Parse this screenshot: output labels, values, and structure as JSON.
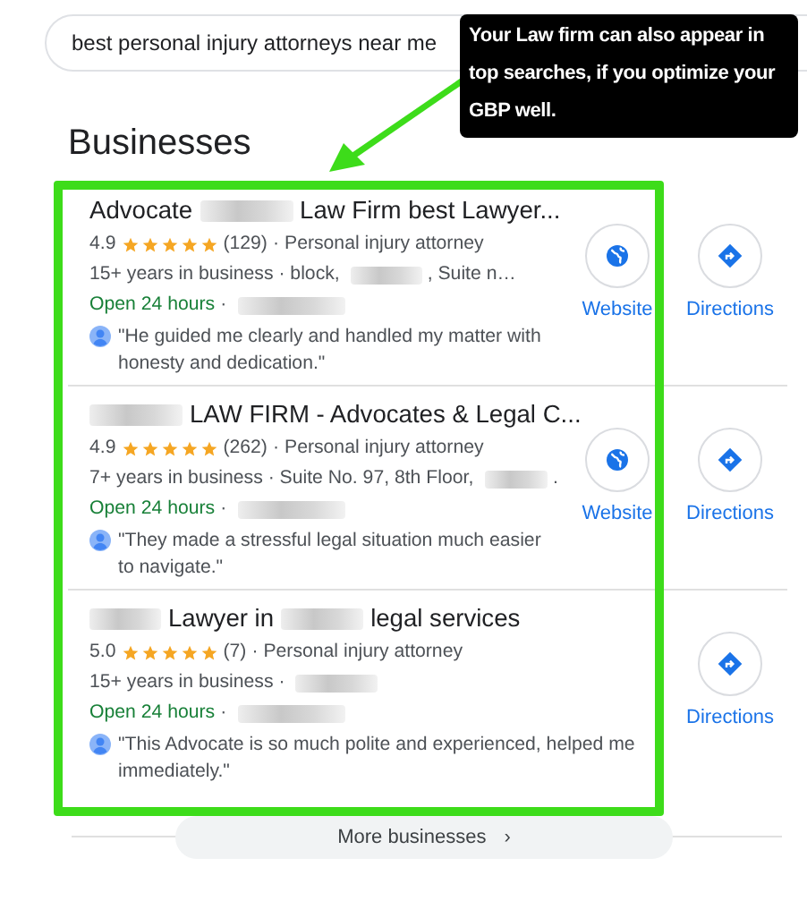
{
  "search": {
    "value": "best personal injury attorneys near me"
  },
  "callout": {
    "text": "Your Law firm can also appear in top searches, if you optimize your GBP well."
  },
  "heading": "Businesses",
  "businesses": [
    {
      "title": [
        {
          "kind": "text",
          "text": "Advocate"
        },
        {
          "kind": "redacted"
        },
        {
          "kind": "text",
          "text": "Law Firm best Lawyer..."
        }
      ],
      "rating": "4.9",
      "stars": 5,
      "reviews": "(129)",
      "separator": "·",
      "category": "Personal injury attorney",
      "details": [
        {
          "kind": "text",
          "text": "15+ years in business · block,"
        },
        {
          "kind": "redacted"
        },
        {
          "kind": "text",
          "text": ", Suite n…"
        }
      ],
      "hours": "Open 24 hours",
      "hours_extra": [
        {
          "kind": "text",
          "text": "·"
        },
        {
          "kind": "redacted"
        }
      ],
      "review": "\"He guided me clearly and handled my matter with honesty and dedication.\"",
      "actions": [
        {
          "kind": "website",
          "label": "Website"
        },
        {
          "kind": "directions",
          "label": "Directions"
        }
      ]
    },
    {
      "title": [
        {
          "kind": "redacted"
        },
        {
          "kind": "text",
          "text": "LAW FIRM - Advocates & Legal C..."
        }
      ],
      "rating": "4.9",
      "stars": 5,
      "reviews": "(262)",
      "separator": "·",
      "category": "Personal injury attorney",
      "details": [
        {
          "kind": "text",
          "text": "7+ years in business · Suite No. 97, 8th Floor,"
        },
        {
          "kind": "redacted"
        },
        {
          "kind": "text",
          "text": "."
        }
      ],
      "hours": "Open 24 hours",
      "hours_extra": [
        {
          "kind": "text",
          "text": "·"
        },
        {
          "kind": "redacted"
        }
      ],
      "review": "\"They made a stressful legal situation much easier to navigate.\"",
      "actions": [
        {
          "kind": "website",
          "label": "Website"
        },
        {
          "kind": "directions",
          "label": "Directions"
        }
      ]
    },
    {
      "title": [
        {
          "kind": "redacted"
        },
        {
          "kind": "text",
          "text": "Lawyer in"
        },
        {
          "kind": "redacted"
        },
        {
          "kind": "text",
          "text": "legal services"
        }
      ],
      "rating": "5.0",
      "stars": 5,
      "reviews": "(7)",
      "separator": "·",
      "category": "Personal injury attorney",
      "details": [
        {
          "kind": "text",
          "text": "15+ years in business ·"
        },
        {
          "kind": "redacted"
        }
      ],
      "hours": "Open 24 hours",
      "hours_extra": [
        {
          "kind": "text",
          "text": "·"
        },
        {
          "kind": "redacted"
        }
      ],
      "review": "\"This Advocate is so much polite and experienced, helped me immediately.\"",
      "actions": [
        {
          "kind": "directions",
          "label": "Directions"
        }
      ]
    }
  ],
  "more": {
    "label": "More businesses",
    "icon": "›"
  }
}
